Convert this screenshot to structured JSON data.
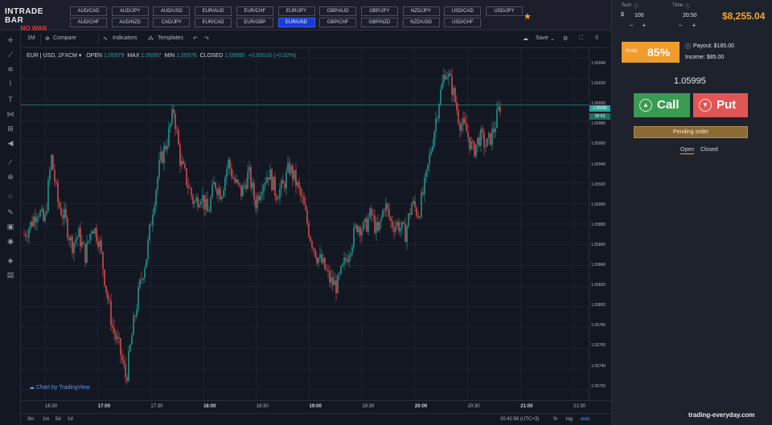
{
  "brand": {
    "line1": "INTRADE BAR",
    "line2": "NO WAR"
  },
  "pairs": [
    [
      "AUD/CAD",
      "AUD/CHF"
    ],
    [
      "AUD/JPY",
      "AUD/NZD"
    ],
    [
      "AUD/USD",
      "CAD/JPY"
    ],
    [
      "EUR/AUD",
      "EUR/CAD"
    ],
    [
      "EUR/CHF",
      "EUR/GBP"
    ],
    [
      "EUR/JPY",
      "EUR/USD"
    ],
    [
      "GBP/AUD",
      "GBP/CHF"
    ],
    [
      "GBP/JPY",
      "GBP/NZD"
    ],
    [
      "NZD/JPY",
      "NZD/USD"
    ],
    [
      "USD/CAD",
      "USD/CHF"
    ],
    [
      "USD/JPY"
    ]
  ],
  "active_pair": "EUR/USD",
  "toolbar": {
    "interval": "1M",
    "compare": "Compare",
    "indicators": "Indicators",
    "templates": "Templates",
    "save": "Save"
  },
  "legend": {
    "symbol": "EUR | USD, 1FXCM",
    "open_label": "OPEN",
    "open": "1.05979",
    "max_label": "MAX",
    "max": "1.05997",
    "min_label": "MIN",
    "min": "1.05976",
    "closed_label": "CLOSED",
    "closed": "1.05995",
    "change": "+0.00016 (+0.02%)"
  },
  "chart_data": {
    "type": "candlestick",
    "symbol": "EUR/USD",
    "y_ticks": [
      "1.06040",
      "1.06020",
      "1.06000",
      "1.05980",
      "1.05960",
      "1.05940",
      "1.05920",
      "1.05900",
      "1.05880",
      "1.05860",
      "1.05840",
      "1.05820",
      "1.05800",
      "1.05780",
      "1.05760",
      "1.05740",
      "1.05720"
    ],
    "ylim": [
      1.0571,
      1.0605
    ],
    "x_ticks": [
      {
        "label": "16:30",
        "bold": false
      },
      {
        "label": "17:00",
        "bold": true
      },
      {
        "label": "17:30",
        "bold": false
      },
      {
        "label": "18:00",
        "bold": true
      },
      {
        "label": "18:30",
        "bold": false
      },
      {
        "label": "19:00",
        "bold": true
      },
      {
        "label": "19:30",
        "bold": false
      },
      {
        "label": "20:00",
        "bold": true
      },
      {
        "label": "20:30",
        "bold": false
      },
      {
        "label": "21:00",
        "bold": true
      },
      {
        "label": "21:30",
        "bold": false
      }
    ],
    "current_price": "1.05995",
    "countdown": "00:03",
    "close_path": [
      1.0587,
      1.0588,
      1.05895,
      1.0588,
      1.05945,
      1.059,
      1.05885,
      1.0586,
      1.0587,
      1.0585,
      1.0588,
      1.05865,
      1.0582,
      1.0578,
      1.0576,
      1.0573,
      1.0578,
      1.0582,
      1.0585,
      1.059,
      1.0594,
      1.0596,
      1.0599,
      1.0594,
      1.0592,
      1.059,
      1.0591,
      1.0589,
      1.0592,
      1.0591,
      1.0594,
      1.0592,
      1.0591,
      1.0593,
      1.059,
      1.0592,
      1.0593,
      1.0591,
      1.05915,
      1.05935,
      1.0592,
      1.059,
      1.0587,
      1.0585,
      1.0584,
      1.05825,
      1.0582,
      1.0584,
      1.0586,
      1.0588,
      1.05875,
      1.0589,
      1.0587,
      1.059,
      1.0588,
      1.0588,
      1.0587,
      1.059,
      1.0589,
      1.0592,
      1.0596,
      1.06,
      1.0603,
      1.0601,
      1.0598,
      1.0597,
      1.0595,
      1.05965,
      1.05955,
      1.0597,
      1.05995
    ]
  },
  "bottom_bar": {
    "ranges": [
      "3m",
      "1m",
      "5d",
      "1d"
    ],
    "clock": "20:42:56 (UTC+3)",
    "pct": "%",
    "log": "log",
    "auto": "auto"
  },
  "attribution": "Chart by TradingView",
  "panel": {
    "sum_label": "Sum",
    "currency": "$",
    "sum_value": "100",
    "time_label": "Time",
    "time_value": "20:50",
    "minus": "−",
    "plus": "+",
    "balance": "$8,255.04",
    "profit_label": "Profit:",
    "profit_value": "85%",
    "payout": "Payout: $185.00",
    "income": "Income: $85.00",
    "price": "1.05995",
    "call": "Call",
    "put": "Put",
    "pending": "Pending order",
    "tab_open": "Open",
    "tab_closed": "Closed"
  },
  "watermark": "trading-everyday.com",
  "colors": {
    "up": "#26a69a",
    "down": "#ef5350",
    "accent": "#f6a623",
    "call": "#3a9b52",
    "put": "#e05656"
  }
}
